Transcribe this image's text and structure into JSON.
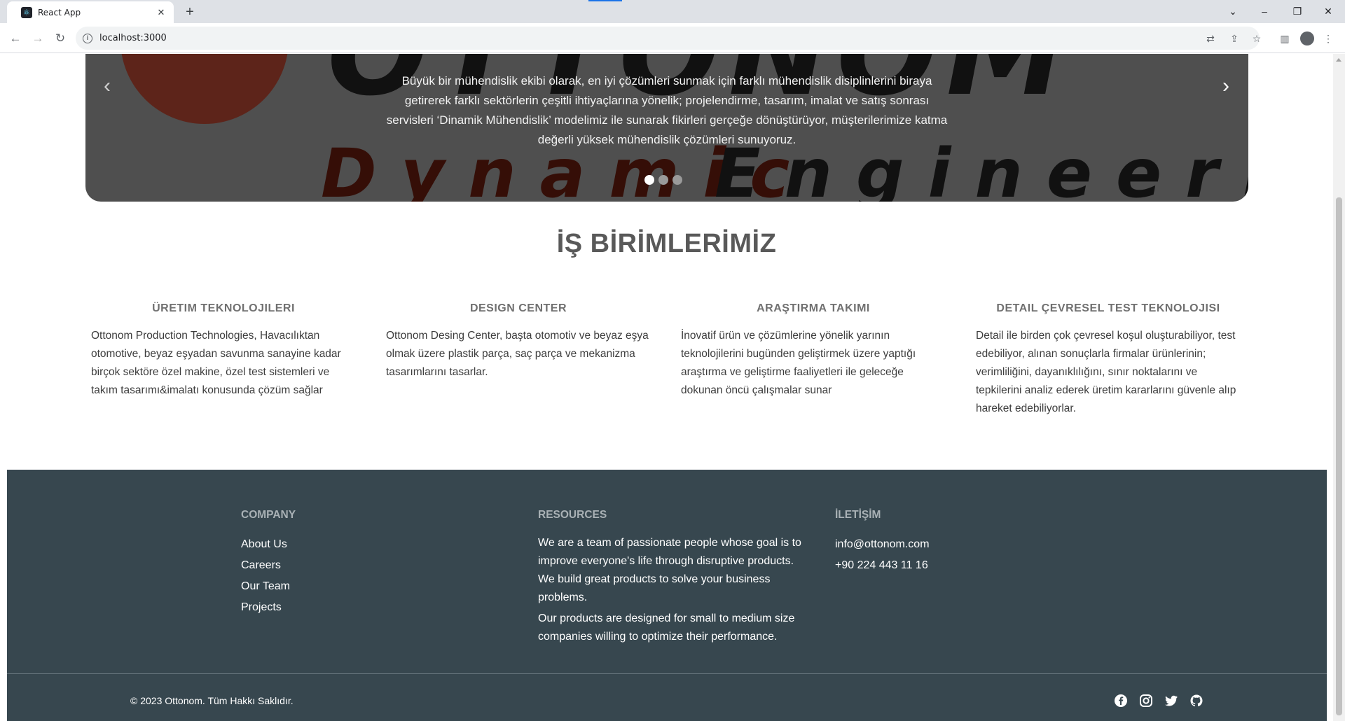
{
  "browser": {
    "tab_title": "React App",
    "url": "localhost:3000"
  },
  "hero": {
    "background_words": [
      "OTTONOM",
      "Dynamic",
      "Engineering"
    ],
    "caption": "Büyük bir mühendislik ekibi olarak, en iyi çözümleri sunmak için farklı mühendislik disiplinlerini biraya getirerek farklı sektörlerin çeşitli ihtiyaçlarına yönelik; projelendirme, tasarım, imalat ve satış sonrası servisleri ‘Dinamik Mühendislik’ modelimiz ile sunarak fikirleri gerçeğe dönüştürüyor, müşterilerimize katma değerli yüksek mühendislik çözümleri sunuyoruz.",
    "slide_count": 3,
    "active_slide": 1
  },
  "units": {
    "title": "İŞ BİRİMLERİMİZ",
    "items": [
      {
        "heading": "ÜRETIM TEKNOLOJILERI",
        "text": "Ottonom Production Technologies, Havacılıktan otomotive, beyaz eşyadan savunma sanayine kadar birçok sektöre özel makine, özel test sistemleri ve takım tasarımı&imalatı konusunda çözüm sağlar"
      },
      {
        "heading": "DESIGN CENTER",
        "text": "Ottonom Desing Center, başta otomotiv ve beyaz eşya olmak üzere plastik parça, saç parça ve mekanizma tasarımlarını tasarlar."
      },
      {
        "heading": "ARAŞTIRMA TAKIMI",
        "text": "İnovatif ürün ve çözümlerine yönelik yarının teknolojilerini bugünden geliştirmek üzere yaptığı araştırma ve geliştirme faaliyetleri ile geleceğe dokunan öncü çalışmalar sunar"
      },
      {
        "heading": "DETAIL ÇEVRESEL TEST TEKNOLOJISI",
        "text": "Detail ile birden çok çevresel koşul oluşturabiliyor, test edebiliyor, alınan sonuçlarla firmalar ürünlerinin; verimliliğini, dayanıklılığını, sınır noktalarını ve tepkilerini analiz ederek üretim kararlarını güvenle alıp hareket edebiliyorlar."
      }
    ]
  },
  "footer": {
    "company": {
      "heading": "COMPANY",
      "links": [
        "About Us",
        "Careers",
        "Our Team",
        "Projects"
      ]
    },
    "resources": {
      "heading": "RESOURCES",
      "paragraphs": [
        "We are a team of passionate people whose goal is to improve everyone's life through disruptive products. We build great products to solve your business problems.",
        "Our products are designed for small to medium size companies willing to optimize their performance."
      ]
    },
    "contact": {
      "heading": "İLETİŞİM",
      "email": "info@ottonom.com",
      "phone": "+90 224 443 11 16"
    },
    "copyright": "© 2023 Ottonom. Tüm Hakkı Saklıdır.",
    "social": [
      "facebook-icon",
      "instagram-icon",
      "twitter-icon",
      "github-icon"
    ]
  },
  "colors": {
    "footer_bg": "#37474f",
    "footer_heading": "#a9b1b5",
    "section_title": "#595959",
    "unit_heading": "#707070"
  }
}
